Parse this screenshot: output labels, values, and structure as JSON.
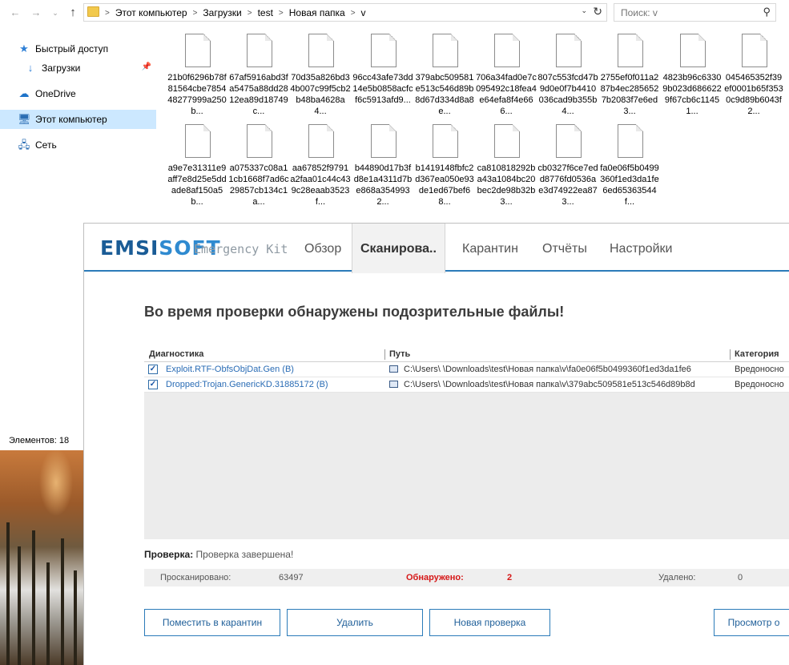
{
  "explorer": {
    "breadcrumbs": [
      "Этот компьютер",
      "Загрузки",
      "test",
      "Новая папка",
      "v"
    ],
    "search_placeholder": "Поиск: v",
    "nav": {
      "quick_access": "Быстрый доступ",
      "downloads": "Загрузки",
      "onedrive": "OneDrive",
      "this_pc": "Этот компьютер",
      "network": "Сеть"
    },
    "status_items": "Элементов: 18",
    "files": [
      {
        "name": "21b0f6296b78f81564cbe785448277999a250b..."
      },
      {
        "name": "67af5916abd3fa5475a88dd2812ea89d18749c..."
      },
      {
        "name": "70d35a826bd34b007c99f5cb2b48ba4628a4..."
      },
      {
        "name": "96cc43afe73dd14e5b0858acfcf6c5913afd9..."
      },
      {
        "name": "379abc509581e513c546d89b8d67d334d8a8e..."
      },
      {
        "name": "706a34fad0e7c095492c18fea4e64efa8f4e666..."
      },
      {
        "name": "807c553fcd47b9d0e0f7b4410036cad9b355b4..."
      },
      {
        "name": "2755ef0f011a287b4ec2856527b2083f7e6ed3..."
      },
      {
        "name": "4823b96c63309b023d6866229f67cb6c11451..."
      },
      {
        "name": "045465352f39ef0001b65f3530c9d89b6043f2..."
      },
      {
        "name": "a9e7e31311e9aff7e8d25e5ddade8af150a5b..."
      },
      {
        "name": "a075337c08a11cb1668f7ad6c29857cb134c1a..."
      },
      {
        "name": "aa67852f9791a2faa01c44c439c28eaab3523f..."
      },
      {
        "name": "b44890d17b3fd8e1a4311d7be868a3549932..."
      },
      {
        "name": "b1419148fbfc2d367ea050e93de1ed67bef68..."
      },
      {
        "name": "ca810818292ba43a1084bc20bec2de98b32b3..."
      },
      {
        "name": "cb0327f6ce7edd8776fd0536ae3d74922ea873..."
      },
      {
        "name": "fa0e06f5b0499360f1ed3da1fe6ed65363544f..."
      }
    ]
  },
  "emsi": {
    "logo_a": "EMSI",
    "logo_b": "SOFT",
    "logo_sub": "Emergency Kit",
    "tabs": [
      "Обзор",
      "Сканирова..",
      "Карантин",
      "Отчёты",
      "Настройки"
    ],
    "active_tab": 1,
    "title": "Во время проверки обнаружены подозрительные файлы!",
    "columns": [
      "Диагностика",
      "Путь",
      "Категория"
    ],
    "rows": [
      {
        "diag": "Exploit.RTF-ObfsObjDat.Gen (B)",
        "path": "C:\\Users\\        \\Downloads\\test\\Новая папка\\v\\fa0e06f5b0499360f1ed3da1fe6",
        "cat": "Вредоносно",
        "checked": true
      },
      {
        "diag": "Dropped:Trojan.GenericKD.31885172 (B)",
        "path": "C:\\Users\\        \\Downloads\\test\\Новая папка\\v\\379abc509581e513c546d89b8d",
        "cat": "Вредоносно",
        "checked": true
      }
    ],
    "status_label": "Проверка:",
    "status_value": "Проверка завершена!",
    "stats": {
      "scanned_label": "Просканировано:",
      "scanned_value": "63497",
      "found_label": "Обнаружено:",
      "found_value": "2",
      "removed_label": "Удалено:",
      "removed_value": "0"
    },
    "buttons": {
      "quarantine": "Поместить в карантин",
      "delete": "Удалить",
      "new_scan": "Новая проверка",
      "view": "Просмотр о"
    }
  }
}
